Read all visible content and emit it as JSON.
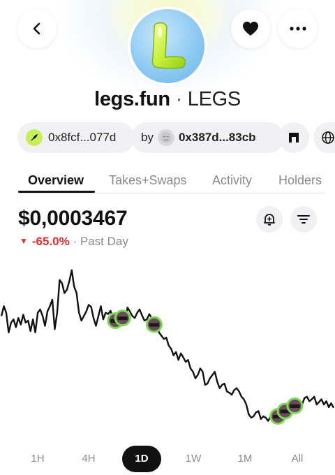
{
  "token": {
    "name": "legs.fun",
    "separator": " · ",
    "symbol": "LEGS",
    "logo_letter": "L"
  },
  "header": {
    "back_icon": "chevron-left-icon",
    "favorite_icon": "heart-icon",
    "more_icon": "ellipsis-icon"
  },
  "chips": {
    "contract": {
      "label": "0x8fcf...077d",
      "icon": "zora-feather-icon"
    },
    "creator": {
      "prefix": "by",
      "address": "0x387d...83cb",
      "icon": "avatar-icon"
    },
    "gateway_icon": "arch-gate-icon",
    "website_icon": "globe-icon"
  },
  "tabs": [
    "Overview",
    "Takes+Swaps",
    "Activity",
    "Holders"
  ],
  "active_tab": "Overview",
  "price": {
    "value": "$0,0003467",
    "change": "-65.0%",
    "period": "· Past Day"
  },
  "actions": {
    "alert_icon": "bell-plus-icon",
    "filter_icon": "filter-lines-icon"
  },
  "chart_data": {
    "type": "line",
    "series": [
      {
        "values": [
          445,
          430,
          440,
          470,
          455,
          450,
          462,
          448,
          458,
          443,
          455,
          452,
          468,
          450,
          470,
          440,
          435,
          445,
          460,
          438,
          430,
          420,
          465,
          440,
          390,
          395,
          410,
          405,
          392,
          375,
          400,
          410,
          440,
          452,
          445,
          438,
          428,
          431,
          448,
          460,
          445,
          430,
          450,
          440,
          442,
          437,
          450,
          452,
          460,
          445,
          448,
          455,
          432,
          438,
          445,
          448,
          440,
          435,
          444,
          452,
          450,
          442,
          448,
          458,
          455,
          470,
          475,
          480,
          478,
          490,
          495,
          505,
          500,
          512,
          502,
          508,
          515,
          512,
          525,
          530,
          540,
          535,
          525,
          530,
          550,
          548,
          540,
          535,
          530,
          545,
          555,
          550,
          548,
          560,
          562,
          565,
          558,
          555,
          560,
          568,
          572,
          580,
          595,
          600,
          598,
          592,
          590,
          602,
          598,
          600,
          605,
          598,
          596,
          600,
          598,
          590,
          585,
          590,
          582,
          578,
          590,
          582,
          575,
          585,
          580,
          570,
          568,
          575,
          572,
          568,
          580,
          576,
          572,
          580,
          575,
          584,
          578,
          585
        ],
        "color": "#111111"
      }
    ],
    "markers": 6,
    "grid": false
  },
  "time_ranges": [
    "1H",
    "4H",
    "1D",
    "1W",
    "1M",
    "All"
  ],
  "active_range": "1D"
}
